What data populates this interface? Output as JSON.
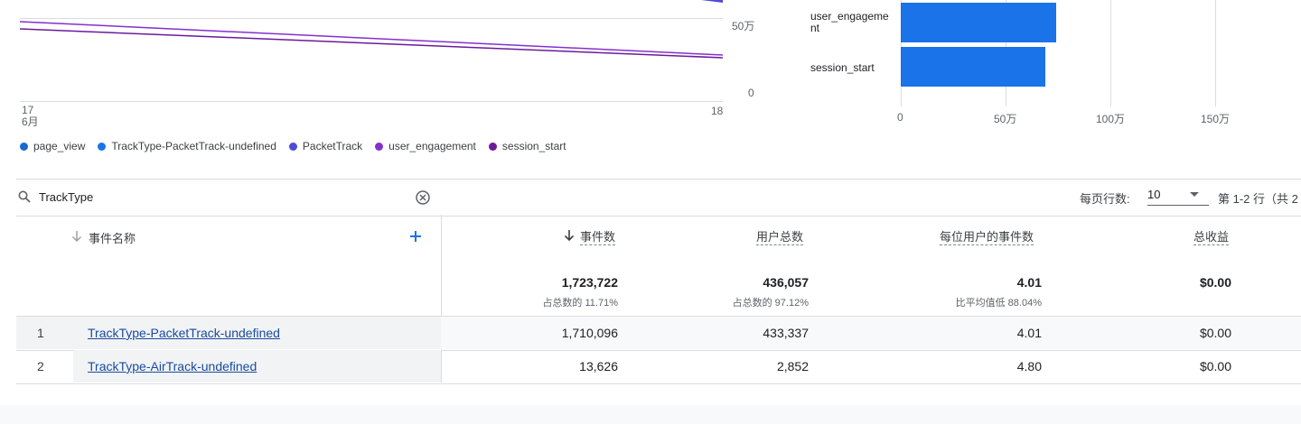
{
  "line_chart": {
    "y_ticks": [
      "50万",
      "0"
    ],
    "x_ticks": [
      {
        "label": "17",
        "sub": "6月"
      },
      {
        "label": "18",
        "sub": ""
      }
    ],
    "legend": [
      {
        "name": "page_view",
        "color": "#1967d2"
      },
      {
        "name": "TrackType-PacketTrack-undefined",
        "color": "#1a73e8"
      },
      {
        "name": "PacketTrack",
        "color": "#4e4bd6"
      },
      {
        "name": "user_engagement",
        "color": "#8430ce"
      },
      {
        "name": "session_start",
        "color": "#6a1b9a"
      }
    ]
  },
  "chart_data": {
    "type": "bar",
    "orientation": "horizontal",
    "categories": [
      "user_engagement",
      "session_start"
    ],
    "values": [
      740000,
      690000
    ],
    "xlim": [
      0,
      1700000
    ],
    "x_ticks": [
      "0",
      "50万",
      "100万",
      "150万"
    ],
    "color": "#1a73e8"
  },
  "bar_chart_labels": {
    "user_engagement": "user_engageme\nnt",
    "session_start": "session_start"
  },
  "search": {
    "value": "TrackType"
  },
  "pagination": {
    "rows_label": "每页行数:",
    "rows_value": "10",
    "range_label": "第 1-2 行（共 2"
  },
  "table": {
    "headers": {
      "event_name": "事件名称",
      "event_count": "事件数",
      "total_users": "用户总数",
      "events_per_user": "每位用户的事件数",
      "total_revenue": "总收益"
    },
    "totals": {
      "event_count": "1,723,722",
      "event_count_sub": "占总数的 11.71%",
      "total_users": "436,057",
      "total_users_sub": "占总数的 97.12%",
      "events_per_user": "4.01",
      "events_per_user_sub": "比平均值低 88.04%",
      "total_revenue": "$0.00"
    },
    "rows": [
      {
        "index": "1",
        "name": "TrackType-PacketTrack-undefined",
        "event_count": "1,710,096",
        "total_users": "433,337",
        "events_per_user": "4.01",
        "total_revenue": "$0.00"
      },
      {
        "index": "2",
        "name": "TrackType-AirTrack-undefined",
        "event_count": "13,626",
        "total_users": "2,852",
        "events_per_user": "4.80",
        "total_revenue": "$0.00"
      }
    ]
  }
}
